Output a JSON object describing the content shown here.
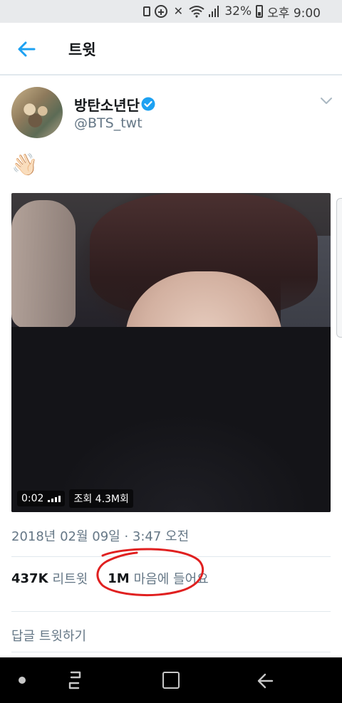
{
  "status_bar": {
    "battery_percent": "32%",
    "time": "오후 9:00",
    "icons": [
      "battery-saver-icon",
      "data-saver-icon",
      "mute-icon",
      "wifi-icon",
      "signal-icon",
      "battery-icon"
    ]
  },
  "header": {
    "title": "트윗",
    "back_icon": "back-arrow-icon"
  },
  "tweet": {
    "author_name": "방탄소년단",
    "author_handle": "@BTS_twt",
    "verified": true,
    "text": "👋🏻",
    "media": {
      "duration": "0:02",
      "views": "조회 4.3M회"
    },
    "timestamp": "2018년 02월 09일 · 3:47 오전",
    "retweets_count": "437K",
    "retweets_label": "리트윗",
    "likes_count": "1M",
    "likes_label": "마음에 들어요",
    "reply_label": "답글 트윗하기"
  },
  "colors": {
    "accent": "#1da1f2",
    "secondary_text": "#657786",
    "annotation": "#e02020"
  }
}
